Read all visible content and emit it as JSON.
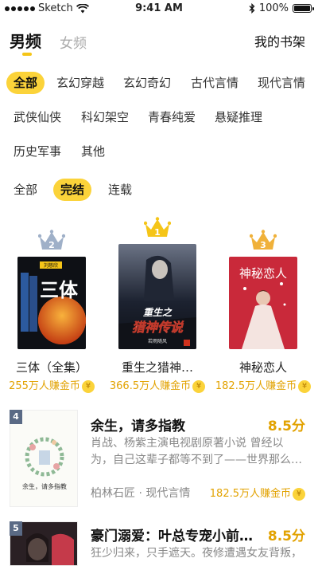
{
  "status_bar": {
    "carrier": "Sketch",
    "time": "9:41 AM",
    "battery": "100%",
    "battery_level": 1.0
  },
  "header": {
    "tabs": [
      {
        "label": "男频",
        "active": true
      },
      {
        "label": "女频",
        "active": false
      }
    ],
    "shelf_label": "我的书架",
    "accent_color": "#fbd33a"
  },
  "categories": [
    "全部",
    "玄幻穿越",
    "玄幻奇幻",
    "古代言情",
    "现代言情",
    "武侠仙侠",
    "科幻架空",
    "青春纯爱",
    "悬疑推理",
    "历史军事",
    "其他"
  ],
  "selected_category": "全部",
  "status_filters": [
    "全部",
    "完结",
    "连载"
  ],
  "selected_status": "完结",
  "podium": [
    {
      "rank": "2",
      "title": "三体（全集）",
      "earn": "255万人赚金币",
      "crown_color": "#9fb0c8"
    },
    {
      "rank": "1",
      "title": "重生之猎神…",
      "earn": "366.5万人赚金币",
      "crown_color": "#f5c518"
    },
    {
      "rank": "3",
      "title": "神秘恋人",
      "earn": "182.5万人赚金币",
      "crown_color": "#f0b13a"
    }
  ],
  "covers": {
    "santi_brand": "刘慈欣",
    "santi_title": "三体",
    "liesheng_title": "重生之猎神传说",
    "liesheng_author": "若雨随风",
    "shenmi_title": "神秘恋人",
    "yusheng_caption": "余生，请多指教"
  },
  "coin_glyph": "¥",
  "list": [
    {
      "rank": "4",
      "title": "余生，请多指教",
      "score": "8.5分",
      "desc": "肖战、杨紫主演电视剧原著小说 曾经以为，自己这辈子都等不到了——世界那么…",
      "author": "柏林石匠",
      "category": "现代言情",
      "earn": "182.5万人赚金币"
    },
    {
      "rank": "5",
      "title": "豪门溺爱：叶总专宠小前…",
      "score": "8.5分",
      "desc": "狂少归来，只手遮天。夜修遭遇女友背叛，"
    }
  ]
}
